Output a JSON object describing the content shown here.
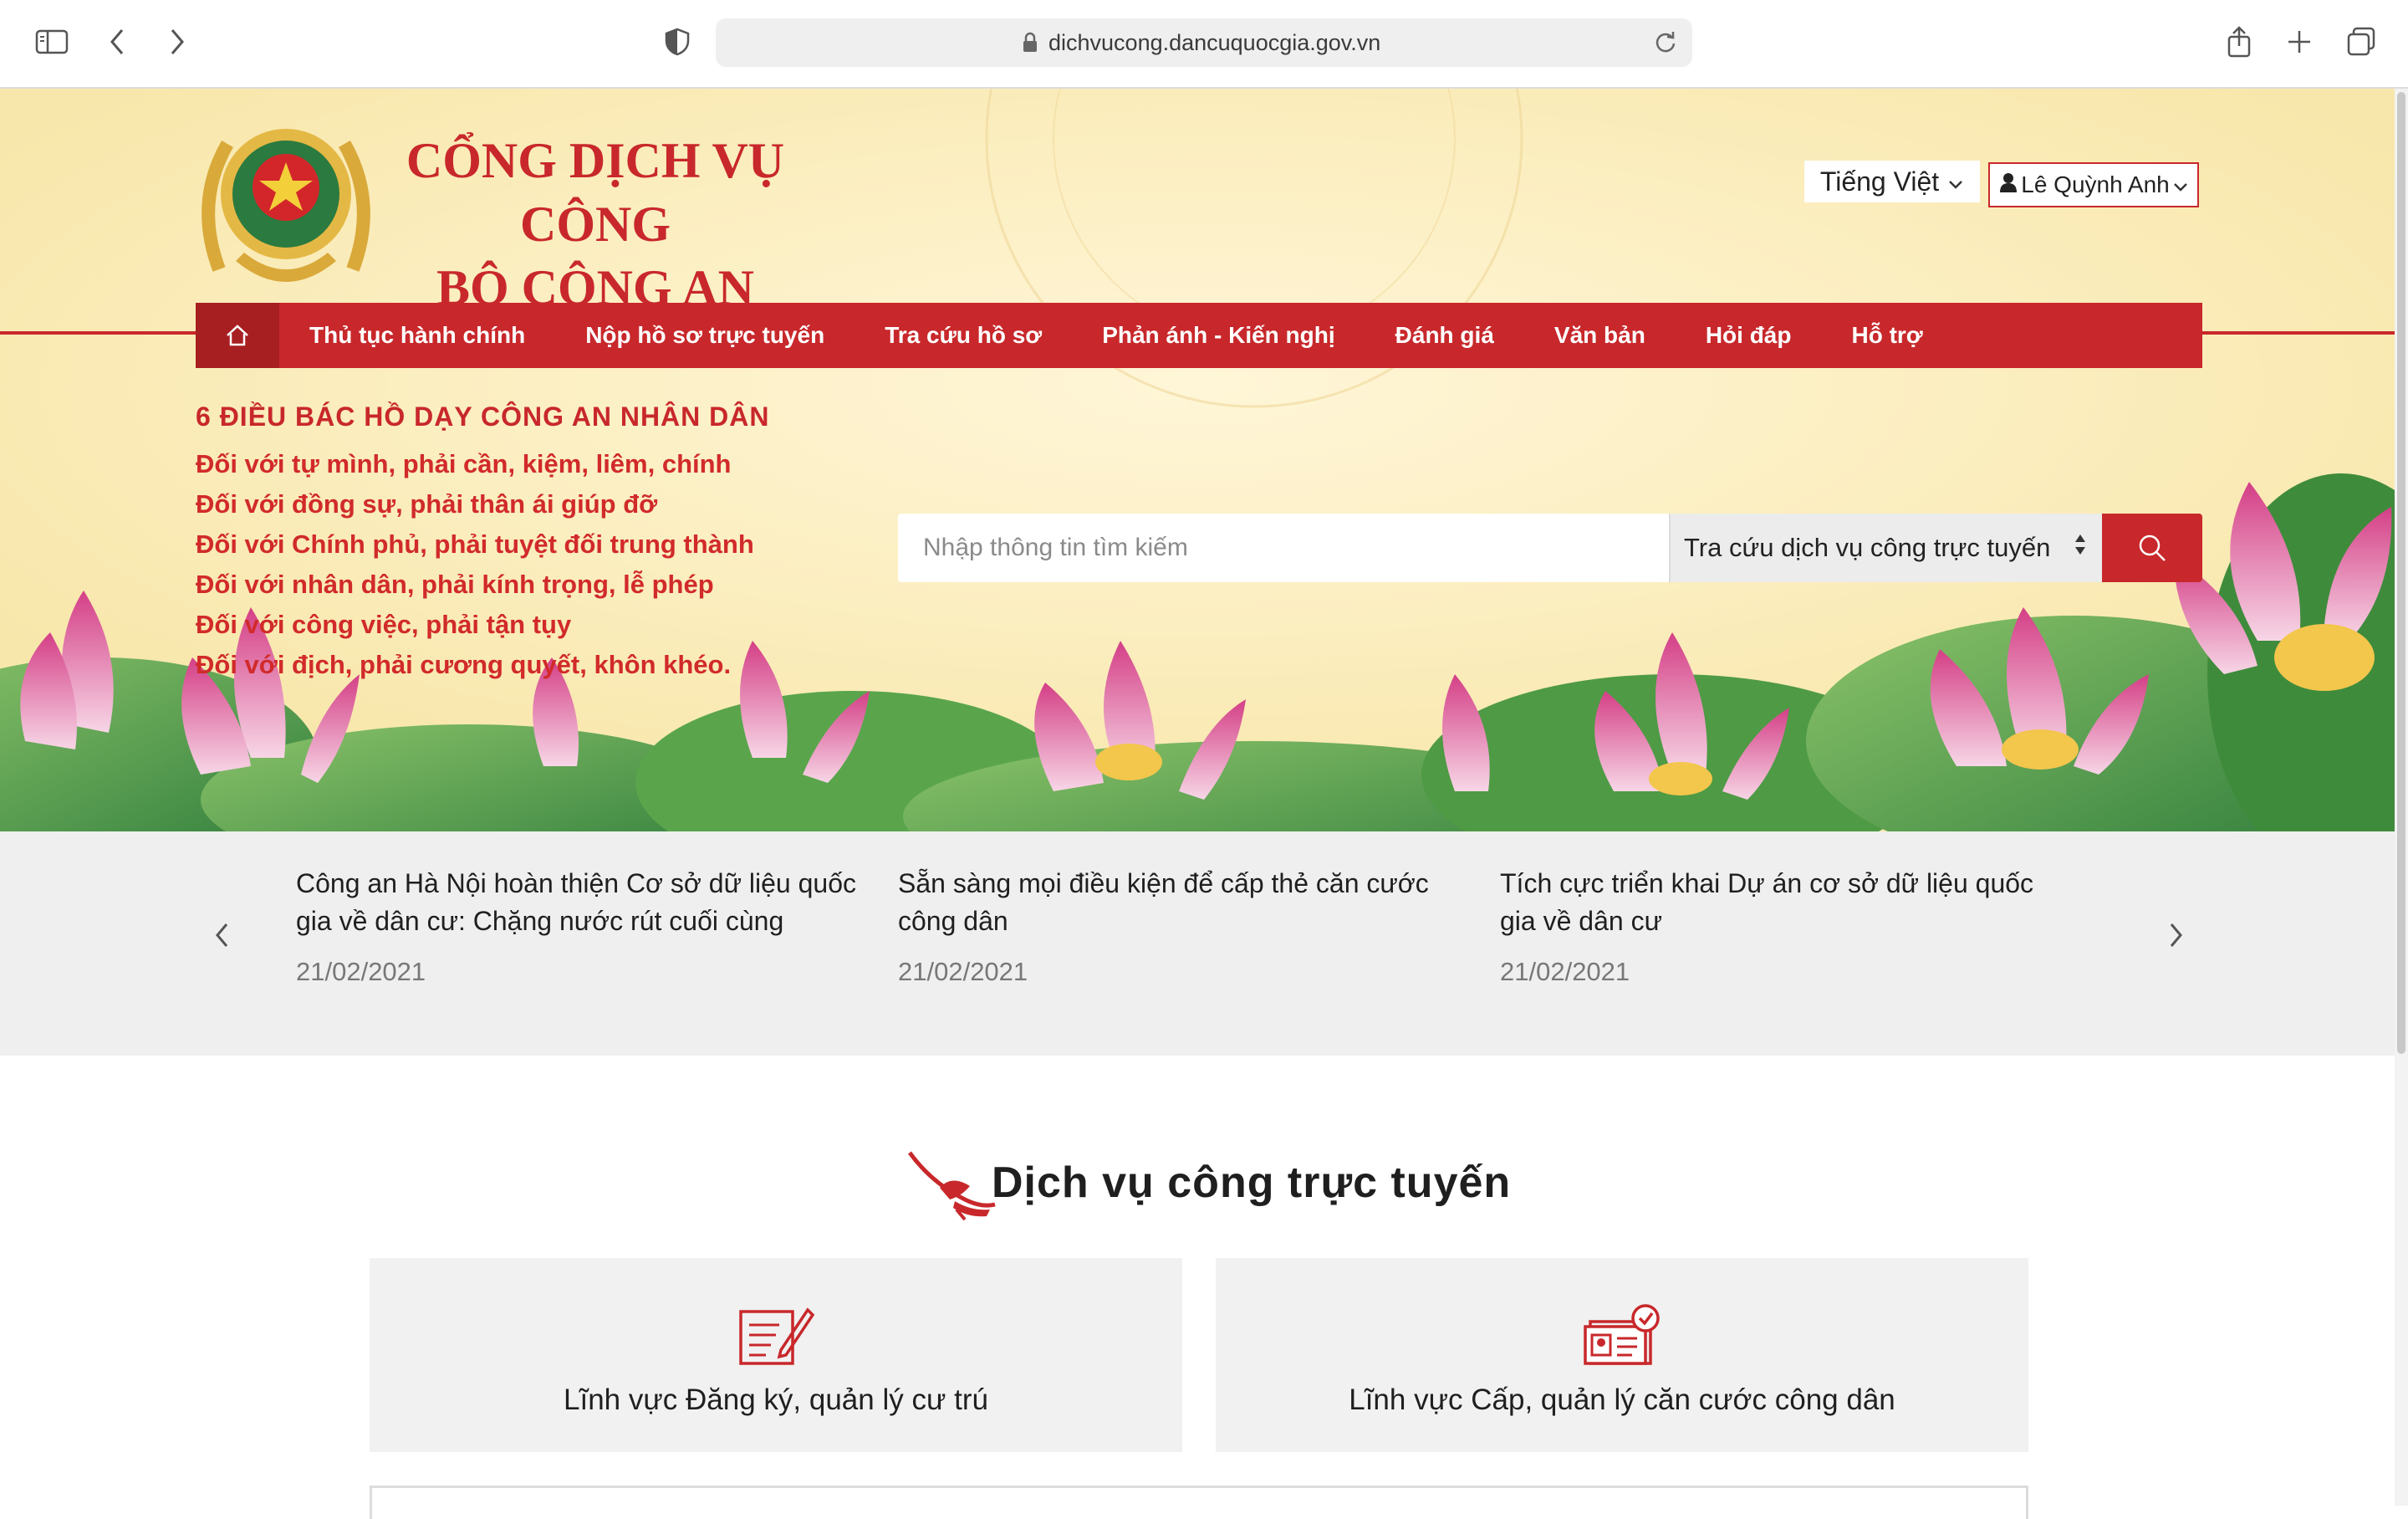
{
  "browser": {
    "url": "dichvucong.dancuquocgia.gov.vn"
  },
  "header": {
    "title_line1": "CỔNG DỊCH VỤ CÔNG",
    "title_line2": "BỘ CÔNG AN",
    "language": "Tiếng Việt",
    "user_name": "Lê Quỳnh Anh"
  },
  "nav": {
    "items": [
      {
        "label": "Thủ tục hành chính"
      },
      {
        "label": "Nộp hồ sơ trực tuyến"
      },
      {
        "label": "Tra cứu hồ sơ"
      },
      {
        "label": "Phản ánh - Kiến nghị"
      },
      {
        "label": "Đánh giá"
      },
      {
        "label": "Văn bản"
      },
      {
        "label": "Hỏi đáp"
      },
      {
        "label": "Hỗ trợ"
      }
    ]
  },
  "teachings": {
    "title": "6 ĐIỀU BÁC HỒ DẠY CÔNG AN NHÂN DÂN",
    "lines": [
      "Đối với tự mình, phải cần, kiệm, liêm, chính",
      "Đối với đồng sự, phải thân ái giúp đỡ",
      "Đối với Chính phủ, phải tuyệt đối trung thành",
      "Đối với nhân dân, phải kính trọng, lễ phép",
      "Đối với công việc, phải tận tụy",
      "Đối với địch, phải cương quyết, khôn khéo."
    ]
  },
  "search": {
    "placeholder": "Nhập thông tin tìm kiếm",
    "value": "",
    "category": "Tra cứu dịch vụ công trực tuyến"
  },
  "news": [
    {
      "title": "Công an Hà Nội hoàn thiện Cơ sở dữ liệu quốc gia về dân cư: Chặng nước rút cuối cùng",
      "date": "21/02/2021"
    },
    {
      "title": "Sẵn sàng mọi điều kiện để cấp thẻ căn cước công dân",
      "date": "21/02/2021"
    },
    {
      "title": "Tích cực triển khai Dự án cơ sở dữ liệu quốc gia về dân cư",
      "date": "21/02/2021"
    }
  ],
  "services": {
    "title": "Dịch vụ công trực tuyến",
    "cards": [
      {
        "label": "Lĩnh vực Đăng ký, quản lý cư trú",
        "icon": "form-edit-icon"
      },
      {
        "label": "Lĩnh vực Cấp, quản lý căn cước công dân",
        "icon": "id-card-check-icon"
      }
    ]
  },
  "colors": {
    "brand_red": "#c8282b",
    "banner_bg": "#fbefc1",
    "news_bg": "#efefef"
  }
}
